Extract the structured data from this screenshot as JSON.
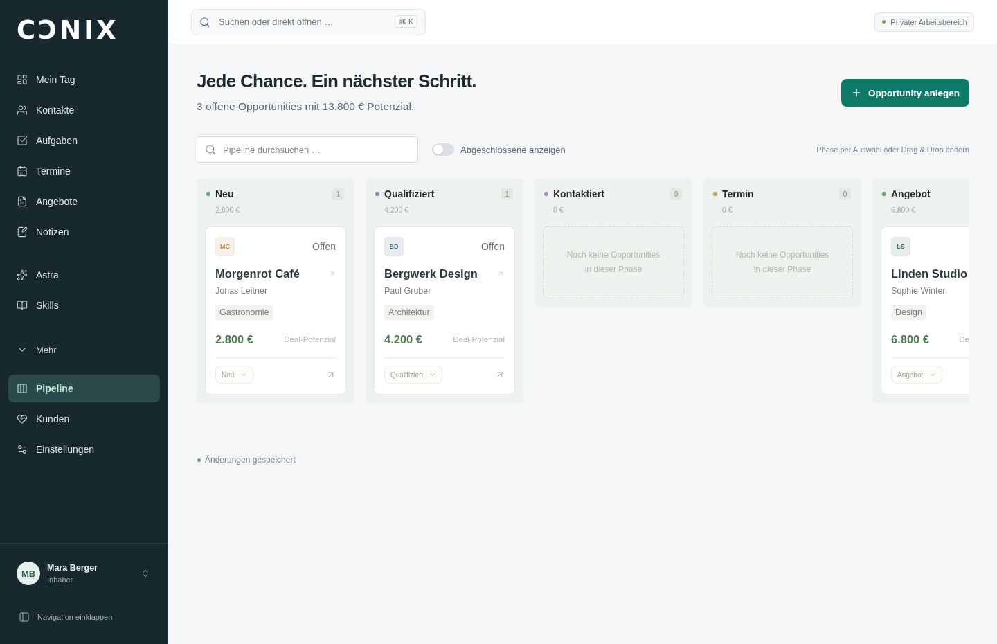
{
  "sidebar": {
    "logo": "CƆNIX",
    "nav_groups": [
      {
        "items": [
          {
            "label": "Mein Tag",
            "selected": false
          },
          {
            "label": "Kontakte",
            "selected": false
          },
          {
            "label": "Aufgaben",
            "selected": false
          },
          {
            "label": "Termine",
            "selected": false
          },
          {
            "label": "Angebote",
            "selected": false
          },
          {
            "label": "Notizen",
            "selected": false
          }
        ]
      },
      {
        "items": [
          {
            "label": "Astra",
            "selected": false
          },
          {
            "label": "Skills",
            "selected": false
          }
        ]
      }
    ],
    "more": {
      "label": "Mehr",
      "expanded": true,
      "items": [
        {
          "label": "Pipeline",
          "selected": true
        },
        {
          "label": "Kunden",
          "selected": false
        },
        {
          "label": "Einstellungen",
          "selected": false
        }
      ]
    },
    "user": {
      "initials": "MB",
      "name": "Mara Berger",
      "role": "Inhaber"
    },
    "collapse_label": "Navigation einklappen"
  },
  "topbar": {
    "search": {
      "placeholder": "Suchen oder direkt öffnen …",
      "shortcut": "⌘ K"
    },
    "workspace": "Privater Arbeitsbereich"
  },
  "header": {
    "title": "Jede Chance. Ein nächster Schritt.",
    "subtitle": "3 offene Opportunities mit 13.800 € Potenzial.",
    "primary_button": "Opportunity anlegen"
  },
  "filters": {
    "search": {
      "placeholder": "Pipeline durchsuchen …"
    },
    "show_closed": {
      "label": "Abgeschlossene anzeigen",
      "on": false
    },
    "hint": "Phase per Auswahl oder Drag & Drop ändern"
  },
  "board": {
    "columns": [
      {
        "title": "Neu",
        "color": "#6b9b7d",
        "count": "1",
        "total": "2.800 €",
        "cut_off": false,
        "cards": [
          {
            "initials": "MC",
            "color": "#b98a4b",
            "status": "Offen",
            "name": "Morgenrot Café",
            "contact": "Jonas Leitner",
            "tag": "Gastronomie",
            "value": "2.800 €",
            "value_label": "Deal-Potenzial",
            "stage": "Neu"
          }
        ]
      },
      {
        "title": "Qualifiziert",
        "color": "#7d8fb0",
        "count": "1",
        "total": "4.200 €",
        "cut_off": false,
        "cards": [
          {
            "initials": "BD",
            "color": "#4f6d90",
            "status": "Offen",
            "name": "Bergwerk Design",
            "contact": "Paul Gruber",
            "tag": "Architektur",
            "value": "4.200 €",
            "value_label": "Deal-Potenzial",
            "stage": "Qualifiziert"
          }
        ]
      },
      {
        "title": "Kontaktiert",
        "color": "#9b8ab5",
        "count": "0",
        "total": "0 €",
        "cut_off": false,
        "empty_text": "Noch keine Opportunities in dieser Phase"
      },
      {
        "title": "Termin",
        "color": "#c2a06a",
        "count": "0",
        "total": "0 €",
        "cut_off": false,
        "empty_text": "Noch keine Opportunities in dieser Phase"
      },
      {
        "title": "Angebot",
        "color": "#6b9b74",
        "total": "6.800 €",
        "cut_off": true,
        "cards": [
          {
            "initials": "LS",
            "color": "#3f6f56",
            "name": "Linden Studio",
            "contact": "Sophie Winter",
            "tag": "Design",
            "value": "6.800 €",
            "value_label": "De",
            "stage": "Angebot"
          }
        ]
      }
    ]
  },
  "footer": {
    "saved": "Änderungen gespeichert"
  }
}
